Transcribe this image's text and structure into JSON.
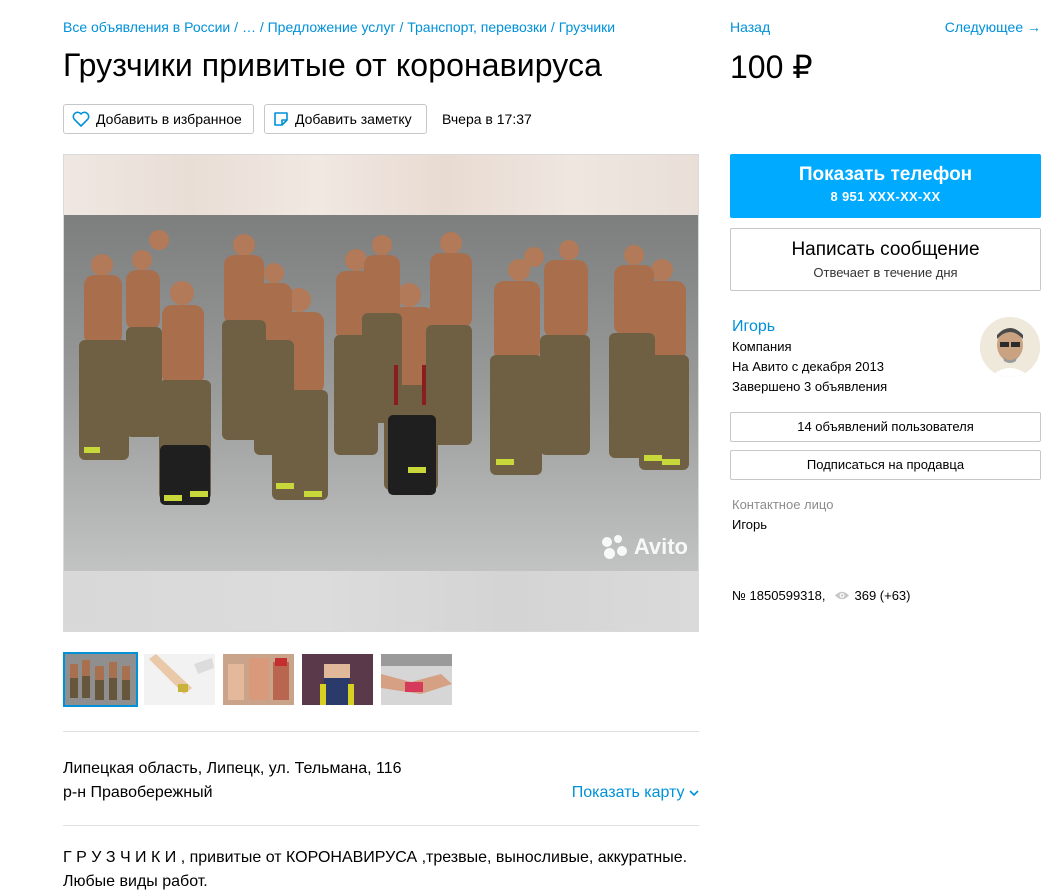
{
  "breadcrumbs": [
    "Все объявления в России",
    "…",
    "Предложение услуг",
    "Транспорт, перевозки",
    "Грузчики"
  ],
  "title": "Грузчики привитые от коронавируса",
  "actions": {
    "favorite_label": "Добавить в избранное",
    "note_label": "Добавить заметку",
    "posted": "Вчера в 17:37"
  },
  "gallery": {
    "watermark": "Avito",
    "thumb_count": 5,
    "active_thumb": 0
  },
  "location": {
    "address": "Липецкая область, Липецк, ул. Тельмана, 116",
    "district": "р-н Правобережный",
    "map_link": "Показать карту"
  },
  "description": "Г Р У З Ч И К И , привитые от КОРОНАВИРУСА ,трезвые, выносливые, аккуратные. Любые виды работ.",
  "nav": {
    "back": "Назад",
    "next": "Следующее →"
  },
  "price": "100 ₽",
  "phone_button": {
    "label": "Показать телефон",
    "number": "8 951 XXX-XX-XX"
  },
  "message_button": {
    "label": "Написать сообщение",
    "sub": "Отвечает в течение дня"
  },
  "seller": {
    "name": "Игорь",
    "type": "Компания",
    "since": "На Авито с декабря 2013",
    "completed": "Завершено 3 объявления",
    "listings_button": "14 объявлений пользователя",
    "subscribe_button": "Подписаться на продавца"
  },
  "contact": {
    "label": "Контактное лицо",
    "name": "Игорь"
  },
  "item": {
    "number": "№ 1850599318,",
    "views": "369 (+63)"
  },
  "colors": {
    "accent": "#00aaff",
    "link": "#0091d9",
    "border": "#c7c7c7"
  }
}
